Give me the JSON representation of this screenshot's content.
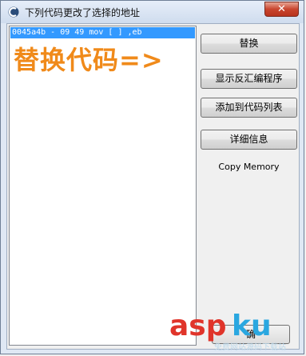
{
  "window": {
    "title": "下列代码更改了选择的地址",
    "close_glyph": "✕"
  },
  "list": {
    "rows": [
      "0045a4b - 09 49 mov [ ] ,eb"
    ],
    "overlay_label": "替换代码=>"
  },
  "buttons": {
    "replace": "替换",
    "show_disassembler": "显示反汇编程序",
    "add_to_codelist": "添加到代码列表",
    "more_info": "详细信息",
    "bottom": "确"
  },
  "copy_memory_label": "Copy Memory",
  "watermark": {
    "brand_a": "asp",
    "brand_b": "ku",
    "sub": "免费网站源码下载站"
  },
  "colors": {
    "selection": "#3399ff",
    "overlay": "#f08a1a",
    "close": "#c9452e"
  }
}
